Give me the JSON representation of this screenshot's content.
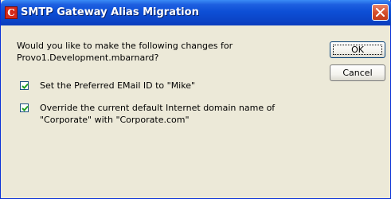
{
  "window": {
    "title": "SMTP Gateway Alias Migration",
    "app_icon_glyph": "C",
    "icons": {
      "app": "app-icon",
      "close": "close-icon"
    }
  },
  "message": {
    "line1": "Would you like to make the following changes for",
    "line2": "Provo1.Development.mbarnard?"
  },
  "options": [
    {
      "checked": true,
      "line1": "Set the Preferred EMail ID to \"Mike\""
    },
    {
      "checked": true,
      "line1": "Override the current default Internet domain name of",
      "line2": "\"Corporate\" with \"Corporate.com\""
    }
  ],
  "buttons": {
    "ok": "OK",
    "cancel": "Cancel"
  },
  "colors": {
    "titlebar": "#0b44c7",
    "close": "#d5502d",
    "face": "#ece9d8",
    "check": "#21a121"
  }
}
